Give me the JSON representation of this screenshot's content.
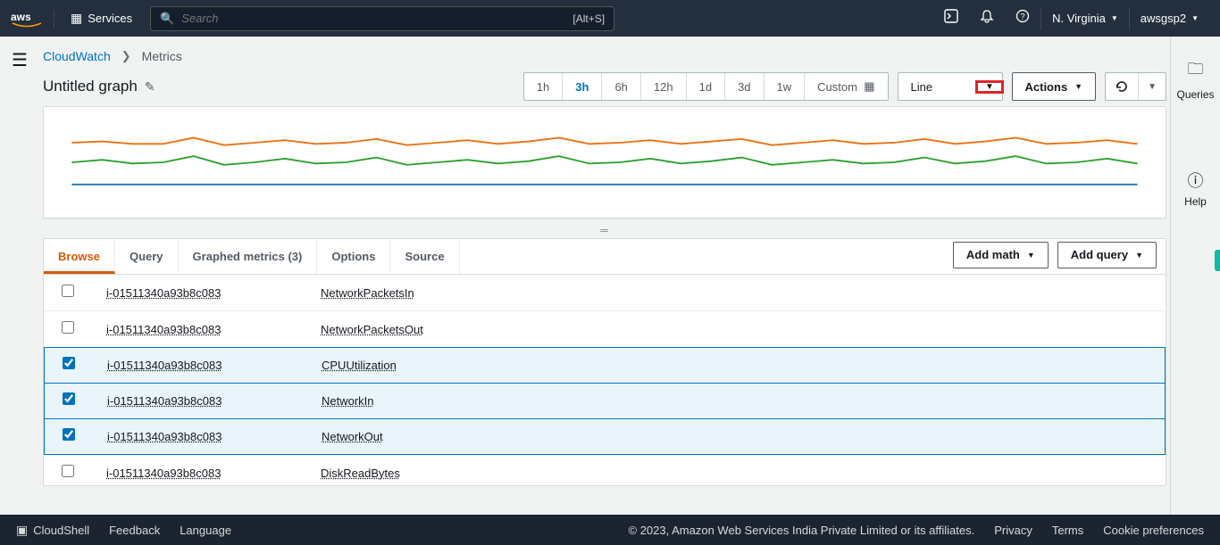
{
  "topnav": {
    "services": "Services",
    "search_placeholder": "Search",
    "search_kbd": "[Alt+S]",
    "region": "N. Virginia",
    "account": "awsgsp2"
  },
  "breadcrumb": {
    "root": "CloudWatch",
    "current": "Metrics"
  },
  "title": "Untitled graph",
  "timerange": {
    "opts": [
      "1h",
      "3h",
      "6h",
      "12h",
      "1d",
      "3d",
      "1w"
    ],
    "active": "3h",
    "custom": "Custom"
  },
  "chart_type_select": "Line",
  "actions_label": "Actions",
  "right_rail": {
    "queries": "Queries",
    "help": "Help"
  },
  "tabs": {
    "browse": "Browse",
    "query": "Query",
    "graphed": "Graphed metrics (3)",
    "options": "Options",
    "source": "Source"
  },
  "right_buttons": {
    "add_math": "Add math",
    "add_query": "Add query"
  },
  "rows": [
    {
      "instance": "i-01511340a93b8c083",
      "metric": "NetworkPacketsIn",
      "checked": false
    },
    {
      "instance": "i-01511340a93b8c083",
      "metric": "NetworkPacketsOut",
      "checked": false
    },
    {
      "instance": "i-01511340a93b8c083",
      "metric": "CPUUtilization",
      "checked": true
    },
    {
      "instance": "i-01511340a93b8c083",
      "metric": "NetworkIn",
      "checked": true
    },
    {
      "instance": "i-01511340a93b8c083",
      "metric": "NetworkOut",
      "checked": true
    },
    {
      "instance": "i-01511340a93b8c083",
      "metric": "DiskReadBytes",
      "checked": false
    }
  ],
  "footer": {
    "cloudshell": "CloudShell",
    "feedback": "Feedback",
    "language": "Language",
    "copyright": "© 2023, Amazon Web Services India Private Limited or its affiliates.",
    "privacy": "Privacy",
    "terms": "Terms",
    "cookies": "Cookie preferences"
  },
  "chart_data": {
    "type": "line",
    "xlabel": "",
    "ylabel": "",
    "x_range": [
      0,
      180
    ],
    "series": [
      {
        "name": "CPUUtilization",
        "color": "#ec7211",
        "values": [
          46,
          47,
          45,
          45,
          50,
          44,
          46,
          48,
          45,
          46,
          49,
          44,
          46,
          48,
          45,
          47,
          50,
          45,
          46,
          48,
          45,
          47,
          49,
          44,
          46,
          48,
          45,
          46,
          49,
          45,
          47,
          50,
          45,
          46,
          48,
          45
        ]
      },
      {
        "name": "NetworkIn",
        "color": "#2ca02c",
        "values": [
          30,
          32,
          29,
          30,
          35,
          28,
          30,
          33,
          29,
          30,
          34,
          28,
          30,
          32,
          29,
          31,
          35,
          29,
          30,
          33,
          29,
          31,
          34,
          28,
          30,
          32,
          29,
          30,
          34,
          29,
          31,
          35,
          29,
          30,
          33,
          29
        ]
      },
      {
        "name": "NetworkOut",
        "color": "#1f77b4",
        "values": [
          12,
          12,
          12,
          12,
          12,
          12,
          12,
          12,
          12,
          12,
          12,
          12,
          12,
          12,
          12,
          12,
          12,
          12,
          12,
          12,
          12,
          12,
          12,
          12,
          12,
          12,
          12,
          12,
          12,
          12,
          12,
          12,
          12,
          12,
          12,
          12
        ]
      }
    ],
    "ylim": [
      0,
      60
    ]
  }
}
